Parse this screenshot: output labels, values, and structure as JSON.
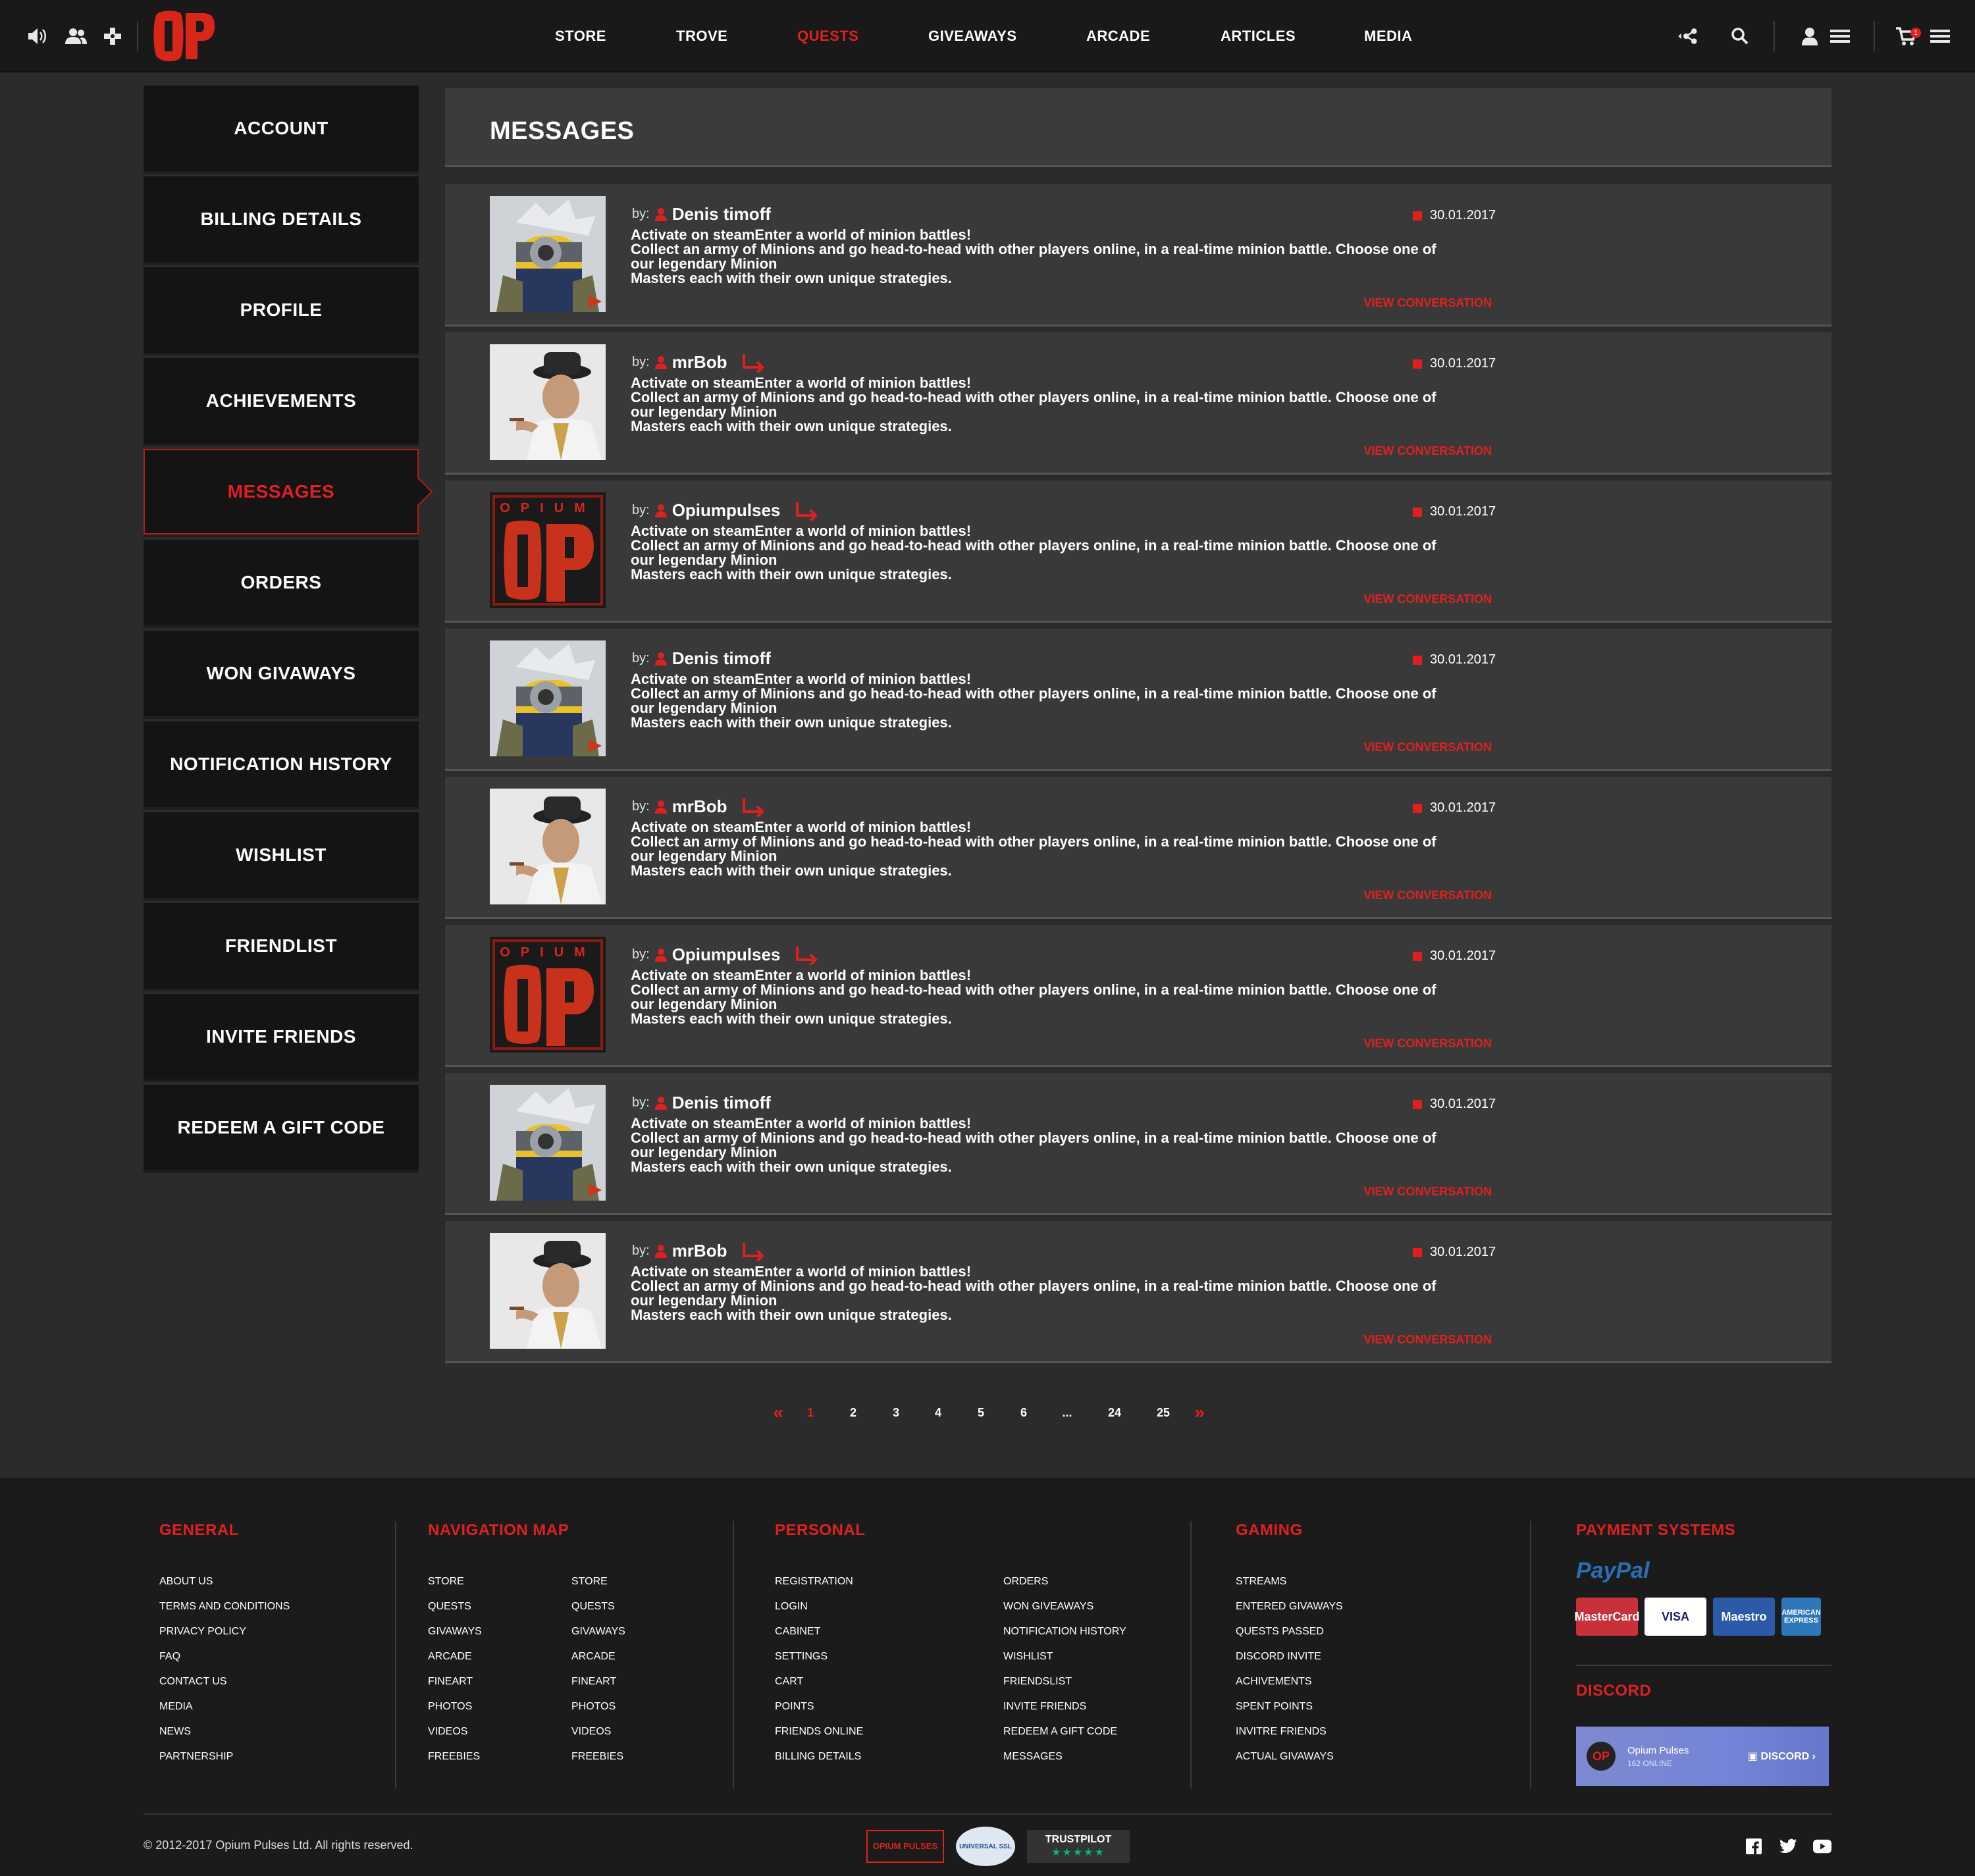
{
  "header": {
    "left_icons": [
      "speaker-icon",
      "users-icon",
      "gamepad-icon"
    ],
    "logo_text": "OP",
    "nav": [
      {
        "label": "STORE",
        "active": false
      },
      {
        "label": "TROVE",
        "active": false
      },
      {
        "label": "QUESTS",
        "active": true
      },
      {
        "label": "GIVEAWAYS",
        "active": false
      },
      {
        "label": "ARCADE",
        "active": false
      },
      {
        "label": "ARTICLES",
        "active": false
      },
      {
        "label": "MEDIA",
        "active": false
      }
    ],
    "right_icons": [
      "share-icon",
      "search-icon",
      "user-icon",
      "menu-icon",
      "cart-icon",
      "hamburger-icon"
    ],
    "cart_count": "1",
    "accent_color": "#e02020"
  },
  "sidebar": {
    "items": [
      {
        "label": "ACCOUNT",
        "active": false
      },
      {
        "label": "BILLING DETAILS",
        "active": false
      },
      {
        "label": "PROFILE",
        "active": false
      },
      {
        "label": "ACHIEVEMENTS",
        "active": false
      },
      {
        "label": "MESSAGES",
        "active": true
      },
      {
        "label": "ORDERS",
        "active": false
      },
      {
        "label": "WON GIVAWAYS",
        "active": false
      },
      {
        "label": "NOTIFICATION HISTORY",
        "active": false
      },
      {
        "label": "WISHLIST",
        "active": false
      },
      {
        "label": "FRIENDLIST",
        "active": false
      },
      {
        "label": "INVITE FRIENDS",
        "active": false
      },
      {
        "label": "REDEEM A GIFT CODE",
        "active": false
      }
    ]
  },
  "main": {
    "title": "MESSAGES",
    "messages": [
      {
        "by": "by:",
        "author": "Denis timoff",
        "avatar": "minion",
        "reply": false,
        "date": "30.01.2017",
        "lines": [
          "Activate on steamEnter a world of minion battles!",
          "Collect an army of Minions and go head-to-head with other players online, in a real-time minion battle. Choose one of",
          "our legendary Minion",
          "Masters each with their own unique strategies."
        ],
        "link": "VIEW CONVERSATION"
      },
      {
        "by": "by:",
        "author": "mrBob",
        "avatar": "hatman",
        "reply": true,
        "date": "30.01.2017",
        "lines": [
          "Activate on steamEnter a world of minion battles!",
          "Collect an army of Minions and go head-to-head with other players online, in a real-time minion battle. Choose one of",
          "our legendary Minion",
          "Masters each with their own unique strategies."
        ],
        "link": "VIEW CONVERSATION"
      },
      {
        "by": "by:",
        "author": "Opiumpulses",
        "avatar": "oplogo",
        "reply": true,
        "date": "30.01.2017",
        "lines": [
          "Activate on steamEnter a world of minion battles!",
          "Collect an army of Minions and go head-to-head with other players online, in a real-time minion battle. Choose one of",
          "our legendary Minion",
          "Masters each with their own unique strategies."
        ],
        "link": "VIEW CONVERSATION"
      },
      {
        "by": "by:",
        "author": "Denis timoff",
        "avatar": "minion",
        "reply": false,
        "date": "30.01.2017",
        "lines": [
          "Activate on steamEnter a world of minion battles!",
          "Collect an army of Minions and go head-to-head with other players online, in a real-time minion battle. Choose one of",
          "our legendary Minion",
          "Masters each with their own unique strategies."
        ],
        "link": "VIEW CONVERSATION"
      },
      {
        "by": "by:",
        "author": "mrBob",
        "avatar": "hatman",
        "reply": true,
        "date": "30.01.2017",
        "lines": [
          "Activate on steamEnter a world of minion battles!",
          "Collect an army of Minions and go head-to-head with other players online, in a real-time minion battle. Choose one of",
          "our legendary Minion",
          "Masters each with their own unique strategies."
        ],
        "link": "VIEW CONVERSATION"
      },
      {
        "by": "by:",
        "author": "Opiumpulses",
        "avatar": "oplogo",
        "reply": true,
        "date": "30.01.2017",
        "lines": [
          "Activate on steamEnter a world of minion battles!",
          "Collect an army of Minions and go head-to-head with other players online, in a real-time minion battle. Choose one of",
          "our legendary Minion",
          "Masters each with their own unique strategies."
        ],
        "link": "VIEW CONVERSATION"
      },
      {
        "by": "by:",
        "author": "Denis timoff",
        "avatar": "minion",
        "reply": false,
        "date": "30.01.2017",
        "lines": [
          "Activate on steamEnter a world of minion battles!",
          "Collect an army of Minions and go head-to-head with other players online, in a real-time minion battle. Choose one of",
          "our legendary Minion",
          "Masters each with their own unique strategies."
        ],
        "link": "VIEW CONVERSATION"
      },
      {
        "by": "by:",
        "author": "mrBob",
        "avatar": "hatman",
        "reply": true,
        "date": "30.01.2017",
        "lines": [
          "Activate on steamEnter a world of minion battles!",
          "Collect an army of Minions and go head-to-head with other players online, in a real-time minion battle. Choose one of",
          "our legendary Minion",
          "Masters each with their own unique strategies."
        ],
        "link": "VIEW CONVERSATION"
      }
    ]
  },
  "pagination": {
    "prev": "«",
    "pages": [
      "1",
      "2",
      "3",
      "4",
      "5",
      "6",
      "...",
      "24",
      "25"
    ],
    "current": "1",
    "next": "»"
  },
  "footer": {
    "general": {
      "title": "GENERAL",
      "items": [
        "ABOUT US",
        "TERMS AND CONDITIONS",
        "PRIVACY POLICY",
        "FAQ",
        "CONTACT US",
        "MEDIA",
        "NEWS",
        "PARTNERSHIP"
      ]
    },
    "navigation": {
      "title": "NAVIGATION MAP",
      "col1": [
        "STORE",
        "QUESTS",
        "GIVAWAYS",
        "ARCADE",
        "FINEART",
        "PHOTOS",
        "VIDEOS",
        "FREEBIES"
      ],
      "col2": [
        "STORE",
        "QUESTS",
        "GIVAWAYS",
        "ARCADE",
        "FINEART",
        "PHOTOS",
        "VIDEOS",
        "FREEBIES"
      ]
    },
    "personal": {
      "title": "PERSONAL",
      "col1": [
        "REGISTRATION",
        "LOGIN",
        "CABINET",
        "SETTINGS",
        "CART",
        "POINTS",
        "FRIENDS ONLINE",
        "BILLING DETAILS"
      ],
      "col2": [
        "ORDERS",
        "WON GIVEAWAYS",
        "NOTIFICATION HISTORY",
        " WISHLIST",
        "FRIENDSLIST",
        "INVITE FRIENDS",
        "REDEEM A GIFT CODE",
        "MESSAGES"
      ]
    },
    "gaming": {
      "title": "GAMING",
      "items": [
        "STREAMS",
        "ENTERED GIVAWAYS",
        "QUESTS PASSED",
        "DISCORD INVITE",
        "ACHIVEMENTS",
        "SPENT POINTS",
        "INVITRE FRIENDS",
        "ACTUAL GIVAWAYS"
      ]
    },
    "payment": {
      "title": "PAYMENT SYSTEMS",
      "paypal": "PayPal",
      "cards": [
        {
          "label": "MasterCard",
          "bg": "#c8313a",
          "fg": "#fff"
        },
        {
          "label": "VISA",
          "bg": "#ffffff",
          "fg": "#1a1f71"
        },
        {
          "label": "Maestro",
          "bg": "#2a5aa8",
          "fg": "#fff"
        },
        {
          "label": "AMERICAN EXPRESS",
          "bg": "#2e77bb",
          "fg": "#fff"
        }
      ]
    },
    "discord": {
      "title": "DISCORD",
      "server": "Opium Pulses",
      "online": "162 ONLINE",
      "button": "DISCORD",
      "logo": "OP"
    },
    "copyright": "© 2012-2017 Opium Pulses Ltd. All rights reserved.",
    "badges": [
      {
        "label": "OPIUM PULSES"
      },
      {
        "label": "UNIVERSAL SSL"
      },
      {
        "label": "TRUSTPILOT"
      }
    ],
    "social": [
      "facebook-icon",
      "twitter-icon",
      "youtube-icon"
    ]
  }
}
